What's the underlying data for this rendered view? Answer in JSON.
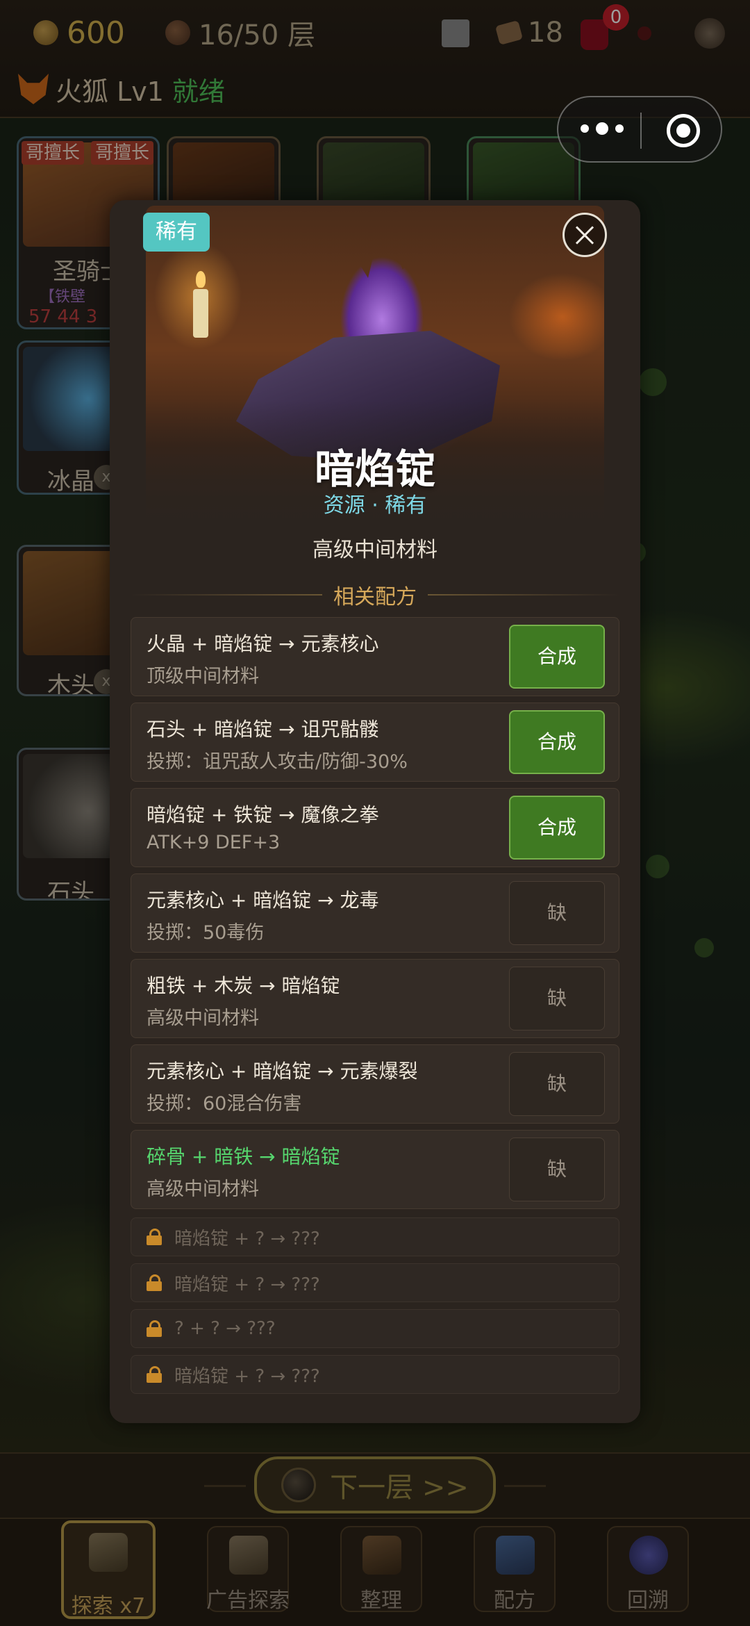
{
  "topbar": {
    "gold": "600",
    "floor": "16/50 层",
    "scrolls": "18",
    "bag_badge": "0"
  },
  "player": {
    "name_level": "火狐 Lv1",
    "status": "就绪"
  },
  "bg_cards": {
    "paladin": {
      "name": "圣骑士",
      "tag1": "哥擅长",
      "tag2": "哥擅长",
      "sub": "【铁壁",
      "stats": "57 44 3"
    },
    "ice": {
      "name": "冰晶",
      "x": "x"
    },
    "wood": {
      "name": "木头",
      "x": "x"
    },
    "stone": {
      "name": "石头"
    }
  },
  "modal": {
    "rarity": "稀有",
    "title": "暗焰锭",
    "subtitle": "资源 · 稀有",
    "description": "高级中间材料",
    "section_label": "相关配方",
    "recipes": [
      {
        "formula": "火晶 + 暗焰锭 → 元素核心",
        "effect": "顶级中间材料",
        "action": "合成"
      },
      {
        "formula": "石头 + 暗焰锭 → 诅咒骷髅",
        "effect": "投掷：诅咒敌人攻击/防御-30%",
        "action": "合成"
      },
      {
        "formula": "暗焰锭 + 铁锭 → 魔像之拳",
        "effect": "ATK+9 DEF+3",
        "action": "合成"
      },
      {
        "formula": "元素核心 + 暗焰锭 → 龙毒",
        "effect": "投掷：50毒伤",
        "action": "缺"
      },
      {
        "formula": "粗铁 + 木炭 → 暗焰锭",
        "effect": "高级中间材料",
        "action": "缺"
      },
      {
        "formula": "元素核心 + 暗焰锭 → 元素爆裂",
        "effect": "投掷：60混合伤害",
        "action": "缺"
      },
      {
        "formula": "碎骨 + 暗铁 → 暗焰锭",
        "effect": "高级中间材料",
        "action": "缺"
      }
    ],
    "locked": [
      "暗焰锭 + ? → ???",
      "暗焰锭 + ? → ???",
      "? + ? → ???",
      "暗焰锭 + ? → ???"
    ]
  },
  "bottom": {
    "next_floor": "下一层 >>",
    "tabs": [
      "探索 x7",
      "广告探索",
      "整理",
      "配方",
      "回溯"
    ]
  },
  "icons": {
    "gold": "coin-icon",
    "floor": "floor-icon",
    "close": "close-icon",
    "lock": "lock-icon"
  },
  "colors": {
    "rarity": "#54c6c2",
    "craft_button": "#3f7a22",
    "ready": "#4fc25a",
    "highlight_formula": "#56d66e",
    "section_label": "#d6a85a"
  }
}
